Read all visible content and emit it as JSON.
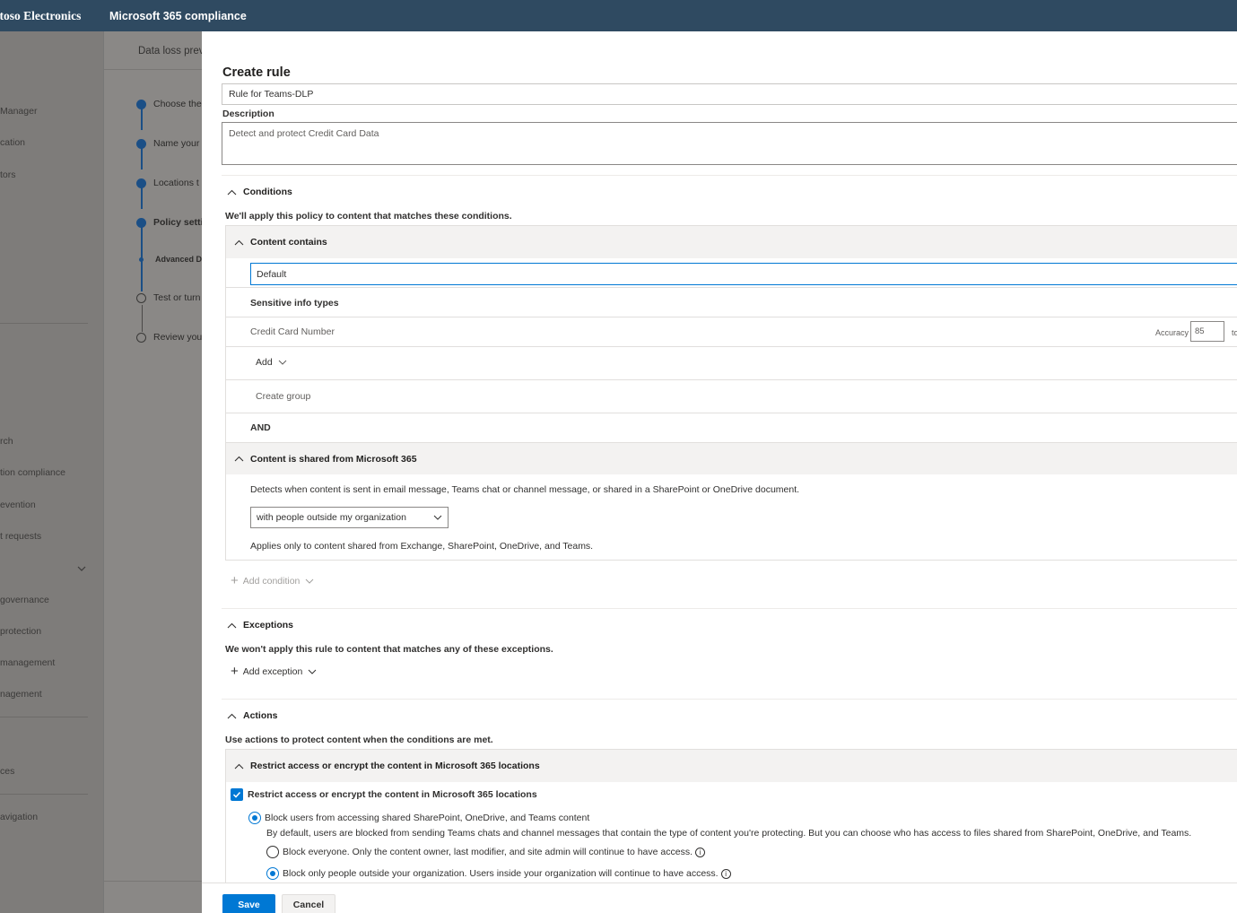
{
  "topbar": {
    "org": "ntoso Electronics",
    "app": "Microsoft 365 compliance"
  },
  "leftnav": {
    "items": [
      {
        "label": "Manager"
      },
      {
        "label": "cation"
      },
      {
        "label": "tors"
      },
      {
        "label": "rch"
      },
      {
        "label": "tion compliance"
      },
      {
        "label": "evention"
      },
      {
        "label": "t requests"
      },
      {
        "label": " governance"
      },
      {
        "label": "protection"
      },
      {
        "label": "management"
      },
      {
        "label": "nagement"
      },
      {
        "label": "ces"
      },
      {
        "label": "avigation"
      }
    ]
  },
  "wizard": {
    "breadcrumb": "Data loss prev",
    "steps": [
      {
        "label": "Choose the",
        "state": "done"
      },
      {
        "label": "Name your",
        "state": "done"
      },
      {
        "label": "Locations t",
        "state": "done"
      },
      {
        "label": "Policy setti",
        "state": "current"
      },
      {
        "label": "Advanced DI",
        "state": "sub"
      },
      {
        "label": "Test or turn",
        "state": "todo"
      },
      {
        "label": "Review you",
        "state": "todo"
      }
    ]
  },
  "panel": {
    "title": "Create rule",
    "name_value": "Rule for Teams-DLP",
    "description_label": "Description",
    "description_value": "Detect and protect Credit Card Data",
    "conditions": {
      "heading": "Conditions",
      "intro": "We'll apply this policy to content that matches these conditions.",
      "content_contains": {
        "heading": "Content contains",
        "group_name": "Default",
        "sit_heading": "Sensitive info types",
        "sit_item": "Credit Card Number",
        "accuracy_label": "Accuracy",
        "accuracy_value": "85",
        "accuracy_to": "to",
        "add_label": "Add",
        "create_group_label": "Create group"
      },
      "and_label": "AND",
      "shared": {
        "heading": "Content is shared from Microsoft 365",
        "description": "Detects when content is sent in email message, Teams chat or channel message, or shared in a SharePoint or OneDrive document.",
        "dropdown_value": "with people outside my organization",
        "note": "Applies only to content shared from Exchange, SharePoint, OneDrive, and Teams."
      },
      "add_condition_label": "Add condition"
    },
    "exceptions": {
      "heading": "Exceptions",
      "intro": "We won't apply this rule to content that matches any of these exceptions.",
      "add_exception_label": "Add exception"
    },
    "actions": {
      "heading": "Actions",
      "intro": "Use actions to protect content when the conditions are met.",
      "restrict_heading": "Restrict access or encrypt the content in Microsoft 365 locations",
      "restrict_checkbox_label": "Restrict access or encrypt the content in Microsoft 365 locations",
      "restrict_checked": true,
      "block_users_label": "Block users from accessing shared SharePoint, OneDrive, and Teams content",
      "block_users_desc": "By default, users are blocked from sending Teams chats and channel messages that contain the type of content you're protecting. But you can choose who has access to files shared from SharePoint, OneDrive, and Teams.",
      "block_everyone_label": "Block everyone. Only the content owner, last modifier, and site admin will continue to have access.",
      "block_outside_label": "Block only people outside your organization. Users inside your organization will continue to have access.",
      "info_glyph": "i"
    },
    "footer": {
      "save_label": "Save",
      "cancel_label": "Cancel"
    }
  }
}
